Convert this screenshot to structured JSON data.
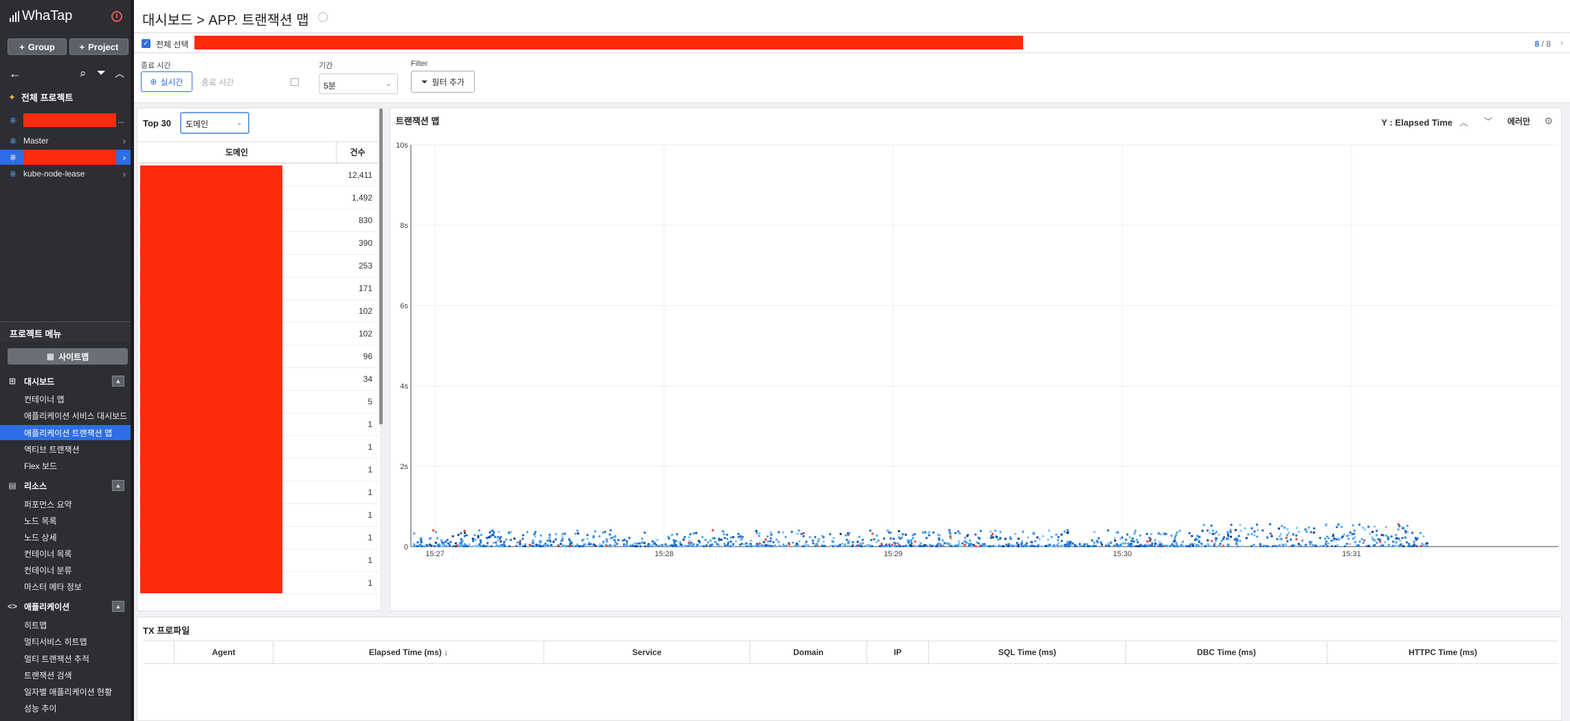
{
  "sidebar": {
    "logo": "WhaTap",
    "group_btn": "Group",
    "project_btn": "Project",
    "all_projects": "전체 프로젝트",
    "projects": [
      {
        "label": "",
        "redacted": true,
        "suffix": "..."
      },
      {
        "label": "Master",
        "redacted": false
      },
      {
        "label": "",
        "redacted": true,
        "active": true
      },
      {
        "label": "kube-node-lease",
        "redacted": false
      }
    ],
    "menu_title": "프로젝트 메뉴",
    "sitemap": "사이트맵",
    "sections": [
      {
        "label": "대시보드",
        "icon": "dashboard-icon",
        "items": [
          "컨테이너 맵",
          "애플리케이션 서비스 대시보드",
          "애플리케이션 트랜잭션 맵",
          "액티브 트랜잭션",
          "Flex 보드"
        ],
        "active_index": 2
      },
      {
        "label": "리소스",
        "icon": "resource-icon",
        "items": [
          "퍼포먼스 요약",
          "노드 목록",
          "노드 상세",
          "컨테이너 목록",
          "컨테이너 분류",
          "마스터 메타 정보"
        ]
      },
      {
        "label": "애플리케이션",
        "icon": "code-icon",
        "items": [
          "히트맵",
          "멀티서비스 히트맵",
          "멀티 트랜잭션 추적",
          "트랜잭션 검색",
          "일자별 애플리케이션 현황",
          "성능 추이"
        ]
      }
    ]
  },
  "header": {
    "title": "대시보드 > APP. 트랜잭션 맵",
    "select_all": "전체 선택",
    "count_selected": "8",
    "count_total": "/ 8"
  },
  "filters": {
    "end_time_label": "종료 시간",
    "realtime_btn": "실시간",
    "end_time_placeholder": "종료 시간",
    "period_label": "기간",
    "period_value": "5분",
    "filter_label": "Filter",
    "filter_btn": "필터 추가"
  },
  "top_table": {
    "top_label": "Top 30",
    "group_by": "도메인",
    "col_domain": "도메인",
    "col_count": "건수",
    "counts": [
      "12,411",
      "1,492",
      "830",
      "390",
      "253",
      "171",
      "102",
      "102",
      "96",
      "34",
      "5",
      "1",
      "1",
      "1",
      "1",
      "1",
      "1",
      "1",
      "1"
    ]
  },
  "tx_map": {
    "title": "트랜잭션 맵",
    "y_select": "Y : Elapsed Time",
    "error_btn": "에러만"
  },
  "chart_data": {
    "type": "scatter",
    "y_ticks": [
      "10s",
      "8s",
      "6s",
      "4s",
      "2s",
      "0"
    ],
    "x_ticks": [
      "15:27",
      "15:28",
      "15:29",
      "15:30",
      "15:31"
    ],
    "ylim": [
      0,
      10
    ],
    "y_unit": "s",
    "point_colors": [
      "#1a6fd6",
      "#4aa3f0",
      "#7fc3ff",
      "#0b3d91",
      "#ff3b30"
    ],
    "grid": true
  },
  "profile": {
    "title": "TX 프로파일",
    "columns": [
      "Agent",
      "Elapsed Time (ms) ↓",
      "Service",
      "Domain",
      "IP",
      "SQL Time (ms)",
      "DBC Time (ms)",
      "HTTPC Time (ms)"
    ]
  }
}
